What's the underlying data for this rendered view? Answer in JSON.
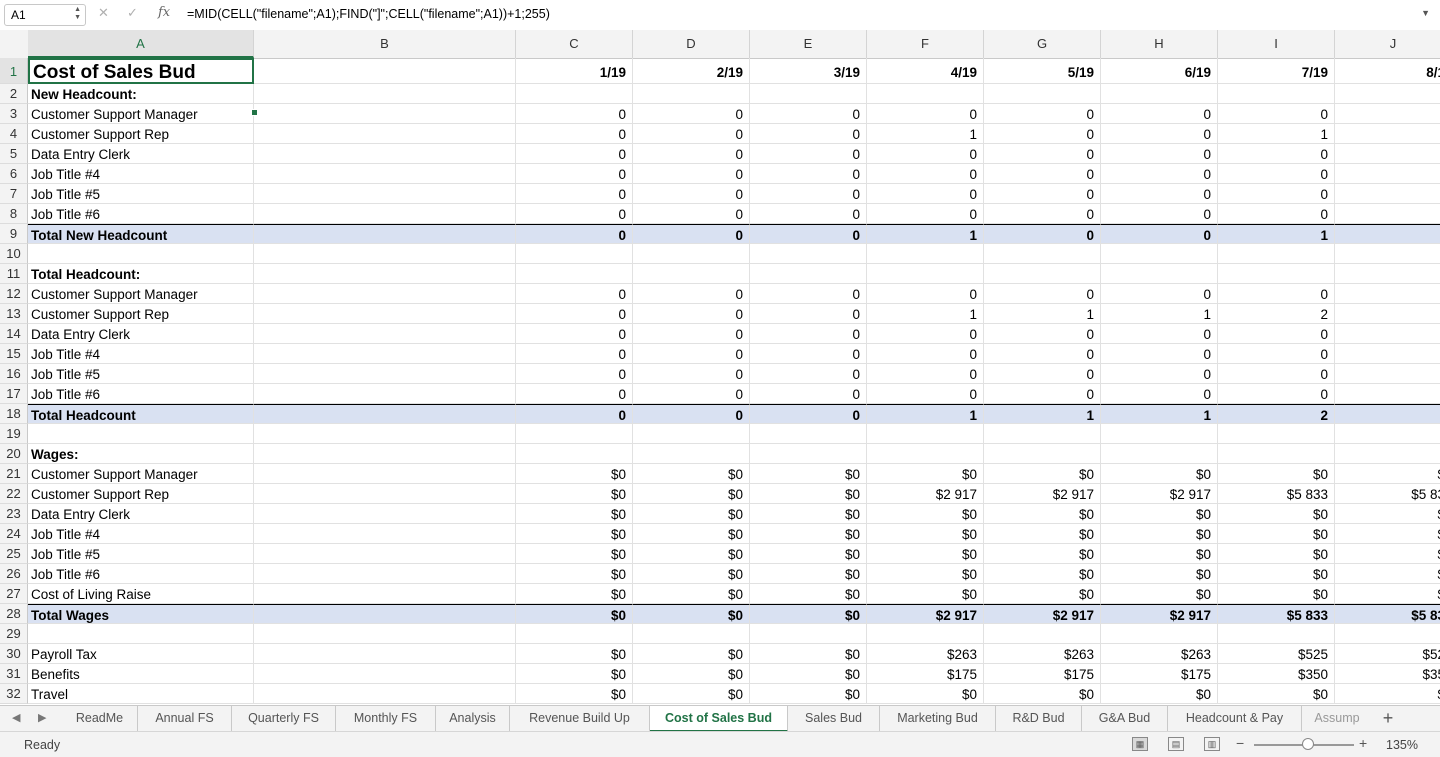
{
  "formula_bar": {
    "name_box": "A1",
    "cancel_glyph": "✕",
    "enter_glyph": "✓",
    "fx_label": "fx",
    "formula": "=MID(CELL(\"filename\";A1);FIND(\"]\";CELL(\"filename\";A1))+1;255)"
  },
  "columns": [
    "A",
    "B",
    "C",
    "D",
    "E",
    "F",
    "G",
    "H",
    "I",
    "J"
  ],
  "months": [
    "1/19",
    "2/19",
    "3/19",
    "4/19",
    "5/19",
    "6/19",
    "7/19",
    "8/1"
  ],
  "rows": [
    {
      "n": "1",
      "label": "Cost of Sales Bud",
      "type": "title",
      "vals": [
        "1/19",
        "2/19",
        "3/19",
        "4/19",
        "5/19",
        "6/19",
        "7/19",
        "8/1"
      ]
    },
    {
      "n": "2",
      "label": "New Headcount:",
      "type": "bold",
      "vals": [
        "",
        "",
        "",
        "",
        "",
        "",
        "",
        ""
      ]
    },
    {
      "n": "3",
      "label": "Customer Support Manager",
      "type": "",
      "vals": [
        "0",
        "0",
        "0",
        "0",
        "0",
        "0",
        "0",
        ""
      ]
    },
    {
      "n": "4",
      "label": "Customer Support Rep",
      "type": "",
      "vals": [
        "0",
        "0",
        "0",
        "1",
        "0",
        "0",
        "1",
        ""
      ]
    },
    {
      "n": "5",
      "label": "Data Entry Clerk",
      "type": "",
      "vals": [
        "0",
        "0",
        "0",
        "0",
        "0",
        "0",
        "0",
        ""
      ]
    },
    {
      "n": "6",
      "label": "Job Title #4",
      "type": "",
      "vals": [
        "0",
        "0",
        "0",
        "0",
        "0",
        "0",
        "0",
        ""
      ]
    },
    {
      "n": "7",
      "label": "Job Title #5",
      "type": "",
      "vals": [
        "0",
        "0",
        "0",
        "0",
        "0",
        "0",
        "0",
        ""
      ]
    },
    {
      "n": "8",
      "label": "Job Title #6",
      "type": "",
      "vals": [
        "0",
        "0",
        "0",
        "0",
        "0",
        "0",
        "0",
        ""
      ]
    },
    {
      "n": "9",
      "label": "Total New Headcount",
      "type": "total",
      "vals": [
        "0",
        "0",
        "0",
        "1",
        "0",
        "0",
        "1",
        ""
      ]
    },
    {
      "n": "10",
      "label": "",
      "type": "",
      "vals": [
        "",
        "",
        "",
        "",
        "",
        "",
        "",
        ""
      ]
    },
    {
      "n": "11",
      "label": "Total Headcount:",
      "type": "bold",
      "vals": [
        "",
        "",
        "",
        "",
        "",
        "",
        "",
        ""
      ]
    },
    {
      "n": "12",
      "label": "Customer Support Manager",
      "type": "",
      "vals": [
        "0",
        "0",
        "0",
        "0",
        "0",
        "0",
        "0",
        ""
      ]
    },
    {
      "n": "13",
      "label": "Customer Support Rep",
      "type": "",
      "vals": [
        "0",
        "0",
        "0",
        "1",
        "1",
        "1",
        "2",
        ""
      ]
    },
    {
      "n": "14",
      "label": "Data Entry Clerk",
      "type": "",
      "vals": [
        "0",
        "0",
        "0",
        "0",
        "0",
        "0",
        "0",
        ""
      ]
    },
    {
      "n": "15",
      "label": "Job Title #4",
      "type": "",
      "vals": [
        "0",
        "0",
        "0",
        "0",
        "0",
        "0",
        "0",
        ""
      ]
    },
    {
      "n": "16",
      "label": "Job Title #5",
      "type": "",
      "vals": [
        "0",
        "0",
        "0",
        "0",
        "0",
        "0",
        "0",
        ""
      ]
    },
    {
      "n": "17",
      "label": "Job Title #6",
      "type": "",
      "vals": [
        "0",
        "0",
        "0",
        "0",
        "0",
        "0",
        "0",
        ""
      ]
    },
    {
      "n": "18",
      "label": "Total Headcount",
      "type": "total",
      "vals": [
        "0",
        "0",
        "0",
        "1",
        "1",
        "1",
        "2",
        ""
      ]
    },
    {
      "n": "19",
      "label": "",
      "type": "",
      "vals": [
        "",
        "",
        "",
        "",
        "",
        "",
        "",
        ""
      ]
    },
    {
      "n": "20",
      "label": "Wages:",
      "type": "bold",
      "vals": [
        "",
        "",
        "",
        "",
        "",
        "",
        "",
        ""
      ]
    },
    {
      "n": "21",
      "label": "Customer Support Manager",
      "type": "",
      "vals": [
        "$0",
        "$0",
        "$0",
        "$0",
        "$0",
        "$0",
        "$0",
        "$"
      ]
    },
    {
      "n": "22",
      "label": "Customer Support Rep",
      "type": "",
      "vals": [
        "$0",
        "$0",
        "$0",
        "$2 917",
        "$2 917",
        "$2 917",
        "$5 833",
        "$5 83"
      ]
    },
    {
      "n": "23",
      "label": "Data Entry Clerk",
      "type": "",
      "vals": [
        "$0",
        "$0",
        "$0",
        "$0",
        "$0",
        "$0",
        "$0",
        "$"
      ]
    },
    {
      "n": "24",
      "label": "Job Title #4",
      "type": "",
      "vals": [
        "$0",
        "$0",
        "$0",
        "$0",
        "$0",
        "$0",
        "$0",
        "$"
      ]
    },
    {
      "n": "25",
      "label": "Job Title #5",
      "type": "",
      "vals": [
        "$0",
        "$0",
        "$0",
        "$0",
        "$0",
        "$0",
        "$0",
        "$"
      ]
    },
    {
      "n": "26",
      "label": "Job Title #6",
      "type": "",
      "vals": [
        "$0",
        "$0",
        "$0",
        "$0",
        "$0",
        "$0",
        "$0",
        "$"
      ]
    },
    {
      "n": "27",
      "label": "Cost of Living Raise",
      "type": "",
      "vals": [
        "$0",
        "$0",
        "$0",
        "$0",
        "$0",
        "$0",
        "$0",
        "$"
      ]
    },
    {
      "n": "28",
      "label": "Total Wages",
      "type": "total",
      "vals": [
        "$0",
        "$0",
        "$0",
        "$2 917",
        "$2 917",
        "$2 917",
        "$5 833",
        "$5 83"
      ]
    },
    {
      "n": "29",
      "label": "",
      "type": "",
      "vals": [
        "",
        "",
        "",
        "",
        "",
        "",
        "",
        ""
      ]
    },
    {
      "n": "30",
      "label": "Payroll Tax",
      "type": "",
      "vals": [
        "$0",
        "$0",
        "$0",
        "$263",
        "$263",
        "$263",
        "$525",
        "$52"
      ]
    },
    {
      "n": "31",
      "label": "Benefits",
      "type": "",
      "vals": [
        "$0",
        "$0",
        "$0",
        "$175",
        "$175",
        "$175",
        "$350",
        "$35"
      ]
    },
    {
      "n": "32",
      "label": "Travel",
      "type": "",
      "vals": [
        "$0",
        "$0",
        "$0",
        "$0",
        "$0",
        "$0",
        "$0",
        "$"
      ]
    }
  ],
  "sheet_tabs": [
    "ReadMe",
    "Annual FS",
    "Quarterly FS",
    "Monthly FS",
    "Analysis",
    "Revenue Build Up",
    "Cost of Sales Bud",
    "Sales Bud",
    "Marketing Bud",
    "R&D Bud",
    "G&A Bud",
    "Headcount & Pay",
    "Assump"
  ],
  "active_tab": "Cost of Sales Bud",
  "tab_nav": {
    "prev": "◀",
    "next": "▶",
    "add": "+"
  },
  "status": {
    "ready": "Ready",
    "zoom": "135%",
    "zoom_minus": "−",
    "zoom_plus": "+"
  },
  "colors": {
    "accent": "#217346",
    "total_fill": "#d9e1f2"
  }
}
